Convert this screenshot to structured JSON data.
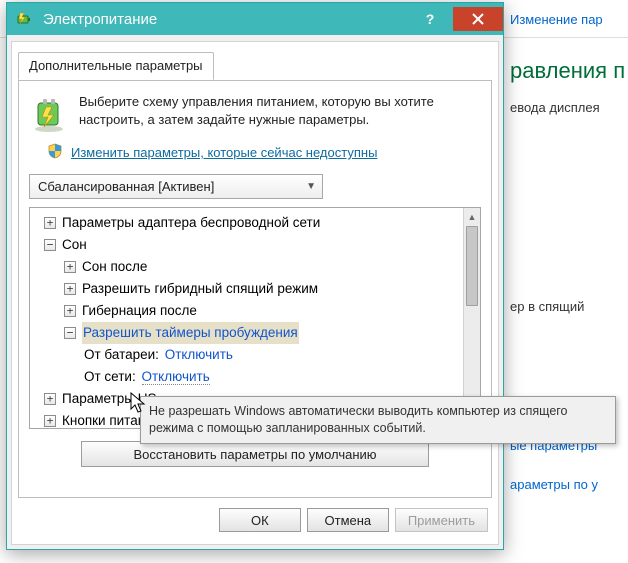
{
  "background": {
    "link_top": "Изменение пар",
    "heading": "равления п",
    "text1": "евода дисплея",
    "text2": "ер в спящий",
    "link_b1": "ые параметры",
    "link_b2": "араметры по у"
  },
  "dialog": {
    "title": "Электропитание",
    "tab": "Дополнительные параметры",
    "intro": "Выберите схему управления питанием, которую вы хотите настроить, а затем задайте нужные параметры.",
    "shield_link": "Изменить параметры, которые сейчас недоступны",
    "combo": "Сбалансированная [Активен]",
    "restore": "Восстановить параметры по умолчанию",
    "buttons": {
      "ok": "ОК",
      "cancel": "Отмена",
      "apply": "Применить"
    }
  },
  "tree": {
    "n0": "Параметры адаптера беспроводной сети",
    "n1": "Сон",
    "n1_0": "Сон после",
    "n1_1": "Разрешить гибридный спящий режим",
    "n1_2": "Гибернация после",
    "n1_3": "Разрешить таймеры пробуждения",
    "n1_3_0_k": "От батареи:",
    "n1_3_0_v": "Отключить",
    "n1_3_1_k": "От сети:",
    "n1_3_1_v": "Отключить",
    "n2": "Параметры US",
    "n3": "Кнопки питан"
  },
  "tooltip": "Не разрешать Windows автоматически выводить компьютер из спящего режима с помощью запланированных событий."
}
